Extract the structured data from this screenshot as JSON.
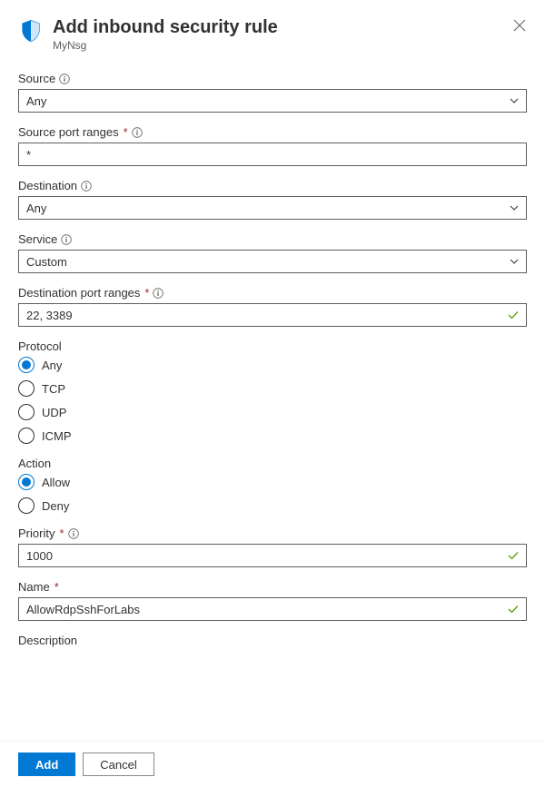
{
  "header": {
    "title": "Add inbound security rule",
    "subtitle": "MyNsg"
  },
  "fields": {
    "source": {
      "label": "Source",
      "value": "Any"
    },
    "sourcePortRanges": {
      "label": "Source port ranges",
      "value": "*"
    },
    "destination": {
      "label": "Destination",
      "value": "Any"
    },
    "service": {
      "label": "Service",
      "value": "Custom"
    },
    "destPortRanges": {
      "label": "Destination port ranges",
      "value": "22, 3389"
    },
    "protocol": {
      "label": "Protocol",
      "options": [
        "Any",
        "TCP",
        "UDP",
        "ICMP"
      ],
      "selected": "Any"
    },
    "action": {
      "label": "Action",
      "options": [
        "Allow",
        "Deny"
      ],
      "selected": "Allow"
    },
    "priority": {
      "label": "Priority",
      "value": "1000"
    },
    "name": {
      "label": "Name",
      "value": "AllowRdpSshForLabs"
    },
    "description": {
      "label": "Description"
    }
  },
  "footer": {
    "add": "Add",
    "cancel": "Cancel"
  }
}
